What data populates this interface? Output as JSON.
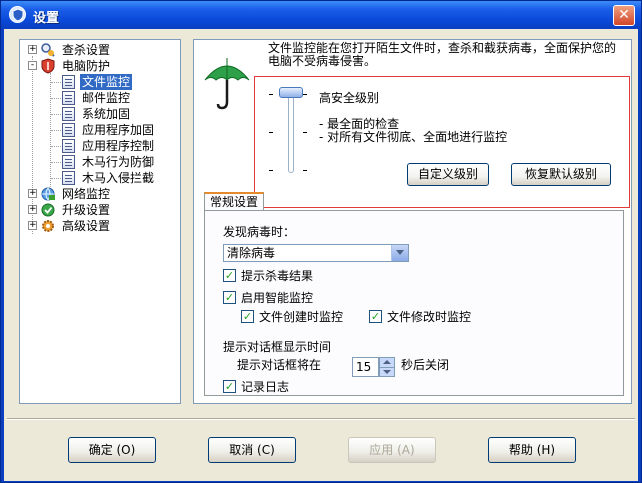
{
  "window": {
    "title": "设置",
    "close_glyph": "✕"
  },
  "tree": {
    "items": [
      {
        "label": "查杀设置",
        "icon": "search-user-icon",
        "expander": "+"
      },
      {
        "label": "电脑防护",
        "icon": "shield-icon",
        "expander": "-"
      },
      {
        "label": "文件监控",
        "icon": "document-icon",
        "selected": true
      },
      {
        "label": "邮件监控",
        "icon": "document-icon"
      },
      {
        "label": "系统加固",
        "icon": "document-icon"
      },
      {
        "label": "应用程序加固",
        "icon": "document-icon"
      },
      {
        "label": "应用程序控制",
        "icon": "document-icon"
      },
      {
        "label": "木马行为防御",
        "icon": "document-icon"
      },
      {
        "label": "木马入侵拦截",
        "icon": "document-icon"
      },
      {
        "label": "网络监控",
        "icon": "network-icon",
        "expander": "+"
      },
      {
        "label": "升级设置",
        "icon": "update-icon",
        "expander": "+"
      },
      {
        "label": "高级设置",
        "icon": "gear-icon",
        "expander": "+"
      }
    ]
  },
  "main": {
    "description": "文件监控能在您打开陌生文件时，查杀和截获病毒，全面保护您的电脑不受病毒侵害。",
    "level": {
      "title": "高安全级别",
      "lines": [
        "- 最全面的检查",
        "- 对所有文件彻底、全面地进行监控"
      ],
      "custom_button": "自定义级别",
      "default_button": "恢复默认级别"
    },
    "tab_label": "常规设置",
    "virus_found_label": "发现病毒时：",
    "virus_action": "清除病毒",
    "checkboxes": {
      "show_result": "提示杀毒结果",
      "smart_monitor": "启用智能监控",
      "file_create": "文件创建时监控",
      "file_modify": "文件修改时监控",
      "log": "记录日志"
    },
    "dialog_time_label": "提示对话框显示时间",
    "dialog_prefix": "提示对话框将在",
    "dialog_seconds": "15",
    "dialog_suffix": "秒后关闭"
  },
  "buttons": {
    "ok": "确定 (O)",
    "cancel": "取消 (C)",
    "apply": "应用 (A)",
    "help": "帮助 (H)"
  },
  "colors": {
    "title_bar": "#0a48d8",
    "selection": "#316ac5",
    "highlight_box": "#e23a3a",
    "tab_accent": "#e68b2c"
  }
}
